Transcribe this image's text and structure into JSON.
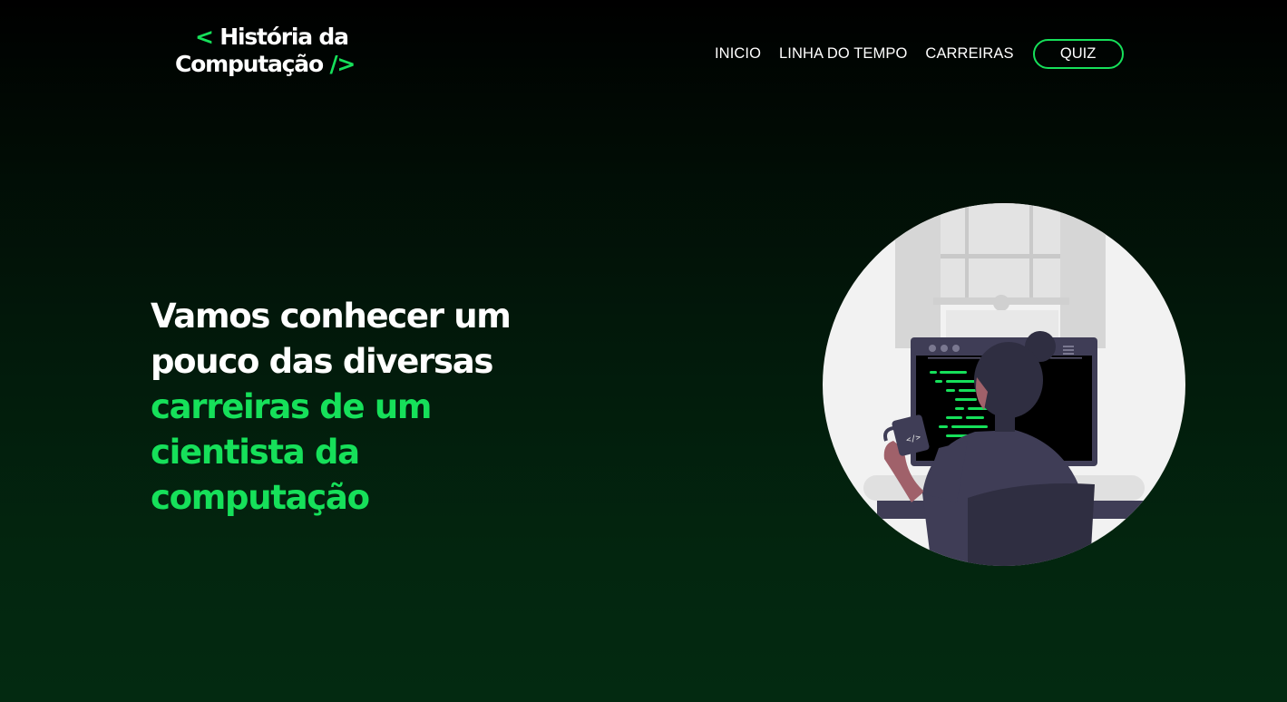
{
  "logo": {
    "open_tag": "<",
    "line1": "História da",
    "line2": "Computação",
    "close_tag": "/>"
  },
  "nav": {
    "items": [
      "INICIO",
      "LINHA DO TEMPO",
      "CARREIRAS"
    ],
    "cta": "QUIZ"
  },
  "hero": {
    "line1": "Vamos conhecer um",
    "line2": "pouco das diversas",
    "line3": "carreiras de um",
    "line4": "cientista da",
    "line5": "computação"
  },
  "illustration": {
    "name": "woman-programming-illustration",
    "mug_label": "</>"
  },
  "colors": {
    "accent": "#16e05a",
    "text": "#ffffff",
    "background_top": "#000000",
    "background_bottom": "#032a11"
  }
}
